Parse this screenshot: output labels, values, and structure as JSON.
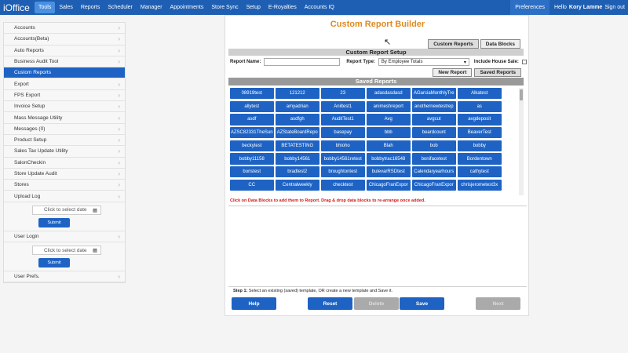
{
  "topbar": {
    "logo": "iOffice",
    "nav": [
      "Tools",
      "Sales",
      "Reports",
      "Scheduler",
      "Manager",
      "Appointments",
      "Store Sync",
      "Setup",
      "E-Royalties",
      "Accounts IQ"
    ],
    "preferences": "Preferences",
    "hello": "Hello",
    "user": "Kory Lamme",
    "signout": "Sign out"
  },
  "sidebar": {
    "items": [
      "Accounts",
      "Accounts(Beta)",
      "Auto Reports",
      "Business Audit Tool",
      "Custom Reports",
      "Export",
      "FPS Export",
      "Invoice Setup",
      "Mass Message Utility",
      "Messages (0)",
      "Product Setup",
      "Sales Tax Update Utility",
      "SalonCheckin",
      "Store Update Audit",
      "Stores",
      "Upload Log",
      "User Login",
      "User Prefs."
    ],
    "date_placeholder": "Click to select date",
    "submit": "Submit"
  },
  "main": {
    "title": "Custom Report Builder",
    "tabs": [
      "Custom Reports",
      "Data Blocks"
    ],
    "setup_title": "Custom Report Setup",
    "report_name_label": "Report Name:",
    "report_type_label": "Report Type:",
    "report_type_value": "By Employee Totals",
    "house_sale_label": "Include House Sale:",
    "new_report": "New Report",
    "saved_reports_btn": "Saved Reports",
    "saved_title": "Saved Reports",
    "reports": [
      "08919test",
      "121212",
      "23",
      "adasdasdasd",
      "AGarciaMonthlyTre",
      "Alkatest",
      "allytest",
      "amyadrian",
      "Aniltest1",
      "animeshreport",
      "anothernewtestrep",
      "as",
      "asdf",
      "asdfgh",
      "AuditTest1",
      "Avg",
      "avgcut",
      "avgdeposit",
      "AZSC82331TheSun",
      "AZStateBoardRepo",
      "basepay",
      "bbb",
      "beardcount",
      "BeaverTest",
      "beckytest",
      "BETATESTING",
      "bhioho",
      "Blah",
      "bob",
      "bobby",
      "bobby11158",
      "bobby14561",
      "bobby14561retest",
      "bobbytrac16548",
      "bonifacetest",
      "Bordentown",
      "boristest",
      "bradtest2",
      "broughtontest",
      "bulevarRSDtest",
      "Calendaryearhours",
      "cathytest",
      "CC",
      "Centralweekly",
      "checktest",
      "ChicagoFranExpor",
      "ChicagoFranExpor",
      "chrisjerometest3x"
    ],
    "hint": "Click on Data Blocks to add them to Report. Drag & drop data blocks to re-arrange once added.",
    "step_label": "Step 1:",
    "step_text": "Select an existing (saved) template, OR create a new template and Save it.",
    "buttons": {
      "help": "Help",
      "reset": "Reset",
      "delete": "Delete",
      "save": "Save",
      "next": "Next"
    }
  }
}
